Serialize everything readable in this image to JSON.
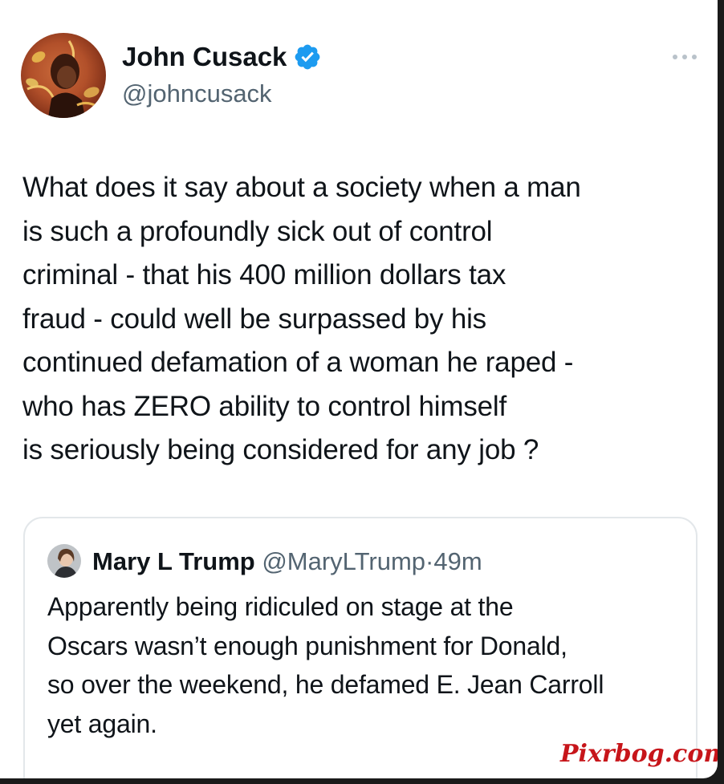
{
  "tweet": {
    "author": {
      "name": "John Cusack",
      "handle": "@johncusack",
      "verified": true,
      "verified_color": "#1d9bf0",
      "avatar_icon": "profile-photo"
    },
    "more_icon": "ellipsis-icon",
    "text": "What does it say about a society when a man\nis such a profoundly sick out of control\ncriminal -  that his 400 million dollars tax\nfraud -  could well be surpassed by his\ncontinued defamation of a woman he raped -\nwho has ZERO ability to control himself\nis seriously being considered for any job ?"
  },
  "quoted_tweet": {
    "author": {
      "name": "Mary L Trump",
      "handle": "@MaryLTrump",
      "avatar_icon": "profile-photo"
    },
    "separator": "·",
    "time": "49m",
    "text": "Apparently being ridiculed on stage at the\nOscars wasn’t enough punishment for Donald,\nso over the weekend, he defamed E. Jean Carroll\nyet again."
  },
  "watermark": {
    "text": "Pixrbog.com",
    "color": "#c7151a"
  },
  "colors": {
    "text_primary": "#0f1419",
    "text_secondary": "#536471",
    "border": "#e3e7ea"
  }
}
